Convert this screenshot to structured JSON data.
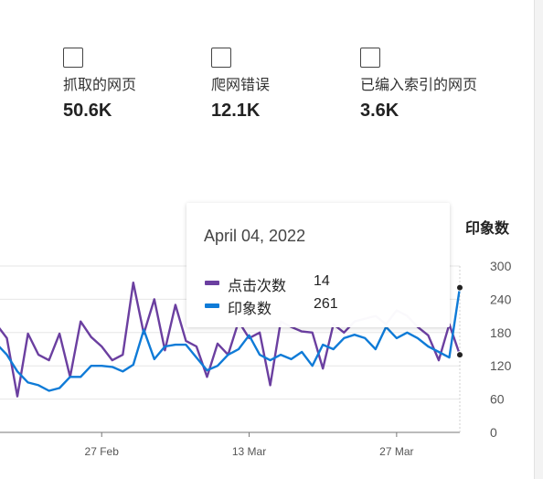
{
  "metrics": [
    {
      "label": "抓取的网页",
      "value": "50.6K"
    },
    {
      "label": "爬网错误",
      "value": "12.1K"
    },
    {
      "label": "已编入索引的网页",
      "value": "3.6K"
    }
  ],
  "axis_title": "印象数",
  "tooltip": {
    "date": "April 04, 2022",
    "rows": [
      {
        "name": "点击次数",
        "value": "14",
        "color": "#6b3fa0"
      },
      {
        "name": "印象数",
        "value": "261",
        "color": "#0f7bd7"
      }
    ]
  },
  "chart_data": {
    "type": "line",
    "ylabel": "印象数",
    "ylim": [
      0,
      300
    ],
    "yticks": [
      0,
      60,
      120,
      180,
      240,
      300
    ],
    "x_tick_labels": [
      {
        "label": "27 Feb",
        "index": 10
      },
      {
        "label": "13 Mar",
        "index": 24
      },
      {
        "label": "27 Mar",
        "index": 38
      }
    ],
    "grid": true,
    "series": [
      {
        "name": "点击次数",
        "color": "#6b3fa0",
        "values": [
          195,
          170,
          65,
          178,
          140,
          130,
          178,
          100,
          200,
          172,
          155,
          130,
          140,
          270,
          178,
          240,
          148,
          230,
          165,
          155,
          100,
          160,
          140,
          200,
          170,
          180,
          85,
          200,
          190,
          182,
          180,
          115,
          195,
          180,
          200,
          205,
          210,
          195,
          220,
          210,
          190,
          175,
          130,
          195,
          140
        ]
      },
      {
        "name": "印象数",
        "color": "#0f7bd7",
        "values": [
          160,
          140,
          110,
          90,
          85,
          75,
          80,
          100,
          100,
          120,
          120,
          118,
          110,
          122,
          185,
          132,
          155,
          158,
          158,
          135,
          112,
          120,
          140,
          150,
          175,
          140,
          130,
          140,
          132,
          145,
          120,
          158,
          150,
          170,
          176,
          170,
          150,
          190,
          170,
          180,
          170,
          155,
          145,
          135,
          261
        ]
      }
    ]
  }
}
